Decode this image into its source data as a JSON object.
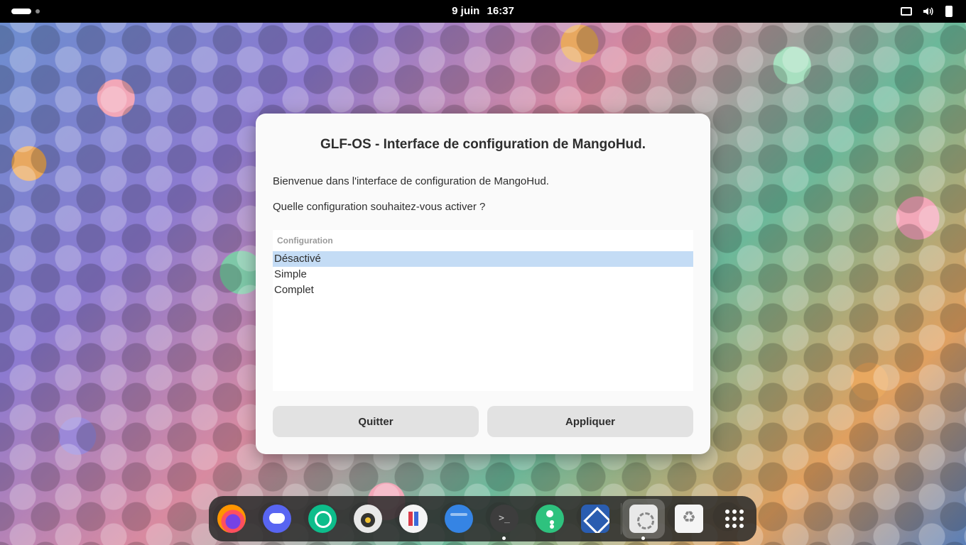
{
  "topbar": {
    "date": "9 juin",
    "time": "16:37",
    "tray_icons": [
      "screen-icon",
      "volume-icon",
      "battery-icon"
    ]
  },
  "dialog": {
    "title": "GLF-OS - Interface de configuration de MangoHud.",
    "welcome": "Bienvenue dans l'interface de configuration de MangoHud.",
    "question": "Quelle configuration souhaitez-vous activer ?",
    "list": {
      "header": "Configuration",
      "items": [
        {
          "label": "Désactivé",
          "selected": true
        },
        {
          "label": "Simple",
          "selected": false
        },
        {
          "label": "Complet",
          "selected": false
        }
      ]
    },
    "buttons": {
      "quit": "Quitter",
      "apply": "Appliquer"
    }
  },
  "dock": {
    "items": [
      "firefox-icon",
      "discord-icon",
      "element-icon",
      "speaker-icon",
      "flathub-icon",
      "files-icon",
      "terminal-icon",
      "keyring-icon",
      "virtualbox-icon",
      "settings-icon",
      "trash-icon",
      "app-grid-icon"
    ],
    "terminal_glyph": ">_",
    "accent": "#3584e4",
    "selection_color": "#c4dcf5"
  }
}
